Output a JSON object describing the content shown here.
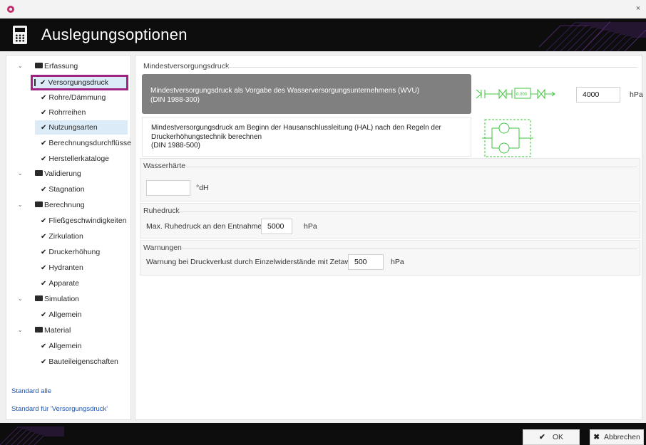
{
  "window": {
    "close_label": "×"
  },
  "header": {
    "title": "Auslegungsoptionen"
  },
  "tree": {
    "erfassung": "Erfassung",
    "versorgungsdruck": "Versorgungsdruck",
    "rohre": "Rohre/Dämmung",
    "rohrreihen": "Rohrreihen",
    "nutzungsarten": "Nutzungsarten",
    "berechnungsdurchfluesse": "Berechnungsdurchflüsse",
    "herstellerkataloge": "Herstellerkataloge",
    "validierung": "Validierung",
    "stagnation": "Stagnation",
    "berechnung": "Berechnung",
    "fliessgeschwindigkeiten": "Fließgeschwindigkeiten",
    "zirkulation": "Zirkulation",
    "druckerhoehung": "Druckerhöhung",
    "hydranten": "Hydranten",
    "apparate": "Apparate",
    "simulation": "Simulation",
    "allgemein1": "Allgemein",
    "material": "Material",
    "allgemein2": "Allgemein",
    "bauteileigenschaften": "Bauteileigenschaften"
  },
  "links": {
    "standard_alle": "Standard alle",
    "standard_fuer": "Standard für 'Versorgungsdruck'"
  },
  "mindest": {
    "title": "Mindestversorgungsdruck",
    "option1_line1": "Mindestversorgungsdruck als Vorgabe des Wasserversorgungsunternehmens (WVU)",
    "option1_line2": "(DIN 1988-300)",
    "option2_line1": "Mindestversorgungsdruck am Beginn der Hausanschlussleitung (HAL) nach den Regeln der",
    "option2_line2": "Druckerhöhungstechnik berechnen",
    "option2_line3": "(DIN 1988-500)",
    "value": "4000",
    "unit": "hPa",
    "meter_label": "0.000"
  },
  "wasserhaerte": {
    "title": "Wasserhärte",
    "value": "",
    "unit": "°dH"
  },
  "ruhedruck": {
    "title": "Ruhedruck",
    "label": "Max. Ruhedruck an den Entnahmen",
    "value": "5000",
    "unit": "hPa"
  },
  "warnungen": {
    "title": "Warnungen",
    "label": "Warnung bei Druckverlust durch Einzelwiderstände mit Zetawert",
    "value": "500",
    "unit": "hPa"
  },
  "footer": {
    "ok_icon": "✔",
    "ok_label": "OK",
    "cancel_icon": "✖",
    "cancel_label": "Abbrechen"
  },
  "colors": {
    "accent_selection": "#a02284",
    "diagram_green": "#3ec43e",
    "header_bg": "#0d0d0d"
  }
}
